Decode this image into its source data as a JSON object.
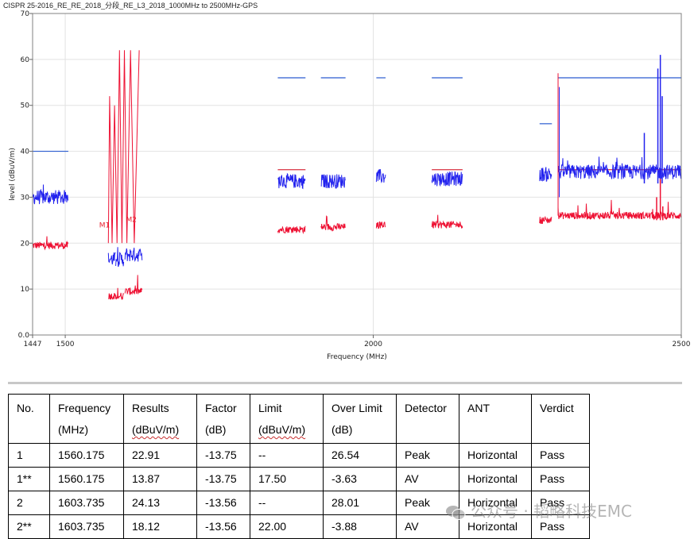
{
  "chart_data": {
    "type": "line",
    "title": "CISPR 25-2016_RE_RE_2018_分段_RE_L3_2018_1000MHz to 2500MHz-GPS",
    "xlabel": "Frequency (MHz)",
    "ylabel": "level (dBuV/m)",
    "xlim": [
      1447,
      2500
    ],
    "ylim": [
      0,
      70
    ],
    "x_ticks": [
      1447,
      1500,
      2000,
      2500
    ],
    "x_tick_labels": [
      "1447",
      "1500",
      "2000",
      "2500"
    ],
    "y_ticks": [
      0,
      10,
      20,
      30,
      40,
      50,
      60,
      70
    ],
    "y_tick_labels": [
      "0.0",
      "10",
      "20",
      "30",
      "40",
      "50",
      "60",
      "70"
    ],
    "grid": true,
    "colors": {
      "peak": "#2222ee",
      "average": "#ee1133",
      "limit_peak": "#2a5bd0",
      "limit_avg": "#d83040"
    },
    "limit_lines": [
      {
        "x": [
          1447,
          1505
        ],
        "level": 40,
        "kind": "peak"
      },
      {
        "x": [
          1845,
          1890
        ],
        "level": 56,
        "kind": "peak"
      },
      {
        "x": [
          1915,
          1955
        ],
        "level": 56,
        "kind": "peak"
      },
      {
        "x": [
          2005,
          2020
        ],
        "level": 56,
        "kind": "peak"
      },
      {
        "x": [
          2095,
          2145
        ],
        "level": 56,
        "kind": "peak"
      },
      {
        "x": [
          2270,
          2290
        ],
        "level": 46,
        "kind": "peak"
      },
      {
        "x": [
          2300,
          2500
        ],
        "level": 56,
        "kind": "peak"
      },
      {
        "x": [
          1845,
          1890
        ],
        "level": 36,
        "kind": "average"
      },
      {
        "x": [
          2095,
          2145
        ],
        "level": 36,
        "kind": "average"
      },
      {
        "x": [
          2300,
          2500
        ],
        "level": 36,
        "kind": "average"
      }
    ],
    "spectrum_segments": [
      {
        "x": [
          1447,
          1505
        ],
        "peak": 30,
        "avg": 19.5
      },
      {
        "x": [
          1570,
          1582
        ],
        "peak": 16.5,
        "avg": 8.5
      },
      {
        "x": [
          1582,
          1595
        ],
        "peak": 16.5,
        "avg": 8.5
      },
      {
        "x": [
          1597,
          1625
        ],
        "peak": 17.5,
        "avg": 9.5
      },
      {
        "x": [
          1845,
          1890
        ],
        "peak": 33.5,
        "avg": 23
      },
      {
        "x": [
          1915,
          1955
        ],
        "peak": 33.5,
        "avg": 23.5
      },
      {
        "x": [
          2005,
          2020
        ],
        "peak": 34.5,
        "avg": 24
      },
      {
        "x": [
          2095,
          2145
        ],
        "peak": 34,
        "avg": 24
      },
      {
        "x": [
          2270,
          2290
        ],
        "peak": 35,
        "avg": 25
      },
      {
        "x": [
          2300,
          2500
        ],
        "peak": 35.5,
        "avg": 26
      }
    ],
    "markers": [
      {
        "label": "M1",
        "x": 1560.175,
        "y": 22.91
      },
      {
        "label": "M2",
        "x": 1603.735,
        "y": 24.13
      }
    ]
  },
  "table": {
    "headers": [
      {
        "line1": "No.",
        "line2": ""
      },
      {
        "line1": "Frequency",
        "line2": "(MHz)"
      },
      {
        "line1": "Results",
        "line2": "(dBuV/m)"
      },
      {
        "line1": "Factor",
        "line2": "(dB)"
      },
      {
        "line1": "Limit",
        "line2": "(dBuV/m)"
      },
      {
        "line1": "Over Limit",
        "line2": "(dB)"
      },
      {
        "line1": "Detector",
        "line2": ""
      },
      {
        "line1": "ANT",
        "line2": ""
      },
      {
        "line1": "Verdict",
        "line2": ""
      }
    ],
    "rows": [
      [
        "1",
        "1560.175",
        "22.91",
        "-13.75",
        "--",
        "26.54",
        "Peak",
        "Horizontal",
        "Pass"
      ],
      [
        "1**",
        "1560.175",
        "13.87",
        "-13.75",
        "17.50",
        "-3.63",
        "AV",
        "Horizontal",
        "Pass"
      ],
      [
        "2",
        "1603.735",
        "24.13",
        "-13.56",
        "--",
        "28.01",
        "Peak",
        "Horizontal",
        "Pass"
      ],
      [
        "2**",
        "1603.735",
        "18.12",
        "-13.56",
        "22.00",
        "-3.88",
        "AV",
        "Horizontal",
        "Pass"
      ]
    ]
  },
  "watermark": {
    "text": "公众号 · 韬略科技EMC",
    "icon": "wechat-icon"
  }
}
